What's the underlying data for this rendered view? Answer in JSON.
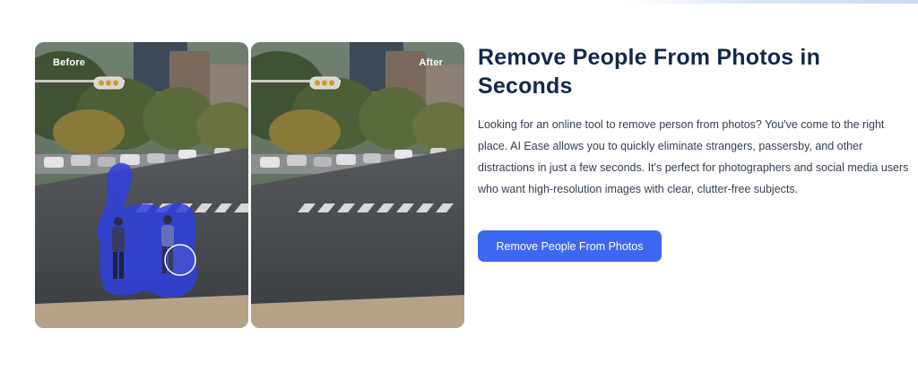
{
  "comparison": {
    "before_label": "Before",
    "after_label": "After"
  },
  "feature": {
    "title": "Remove People From Photos in Seconds",
    "description": "Looking for an online tool to remove person from photos? You've come to the right place. AI Ease allows you to quickly eliminate strangers, passersby, and other distractions in just a few seconds. It's perfect for photographers and social media users who want high-resolution images with clear, clutter-free subjects.",
    "cta_label": "Remove People From Photos"
  },
  "colors": {
    "title": "#14294a",
    "body_text": "#34404f",
    "accent": "#3e67f1",
    "mask": "#2f3fe0"
  }
}
